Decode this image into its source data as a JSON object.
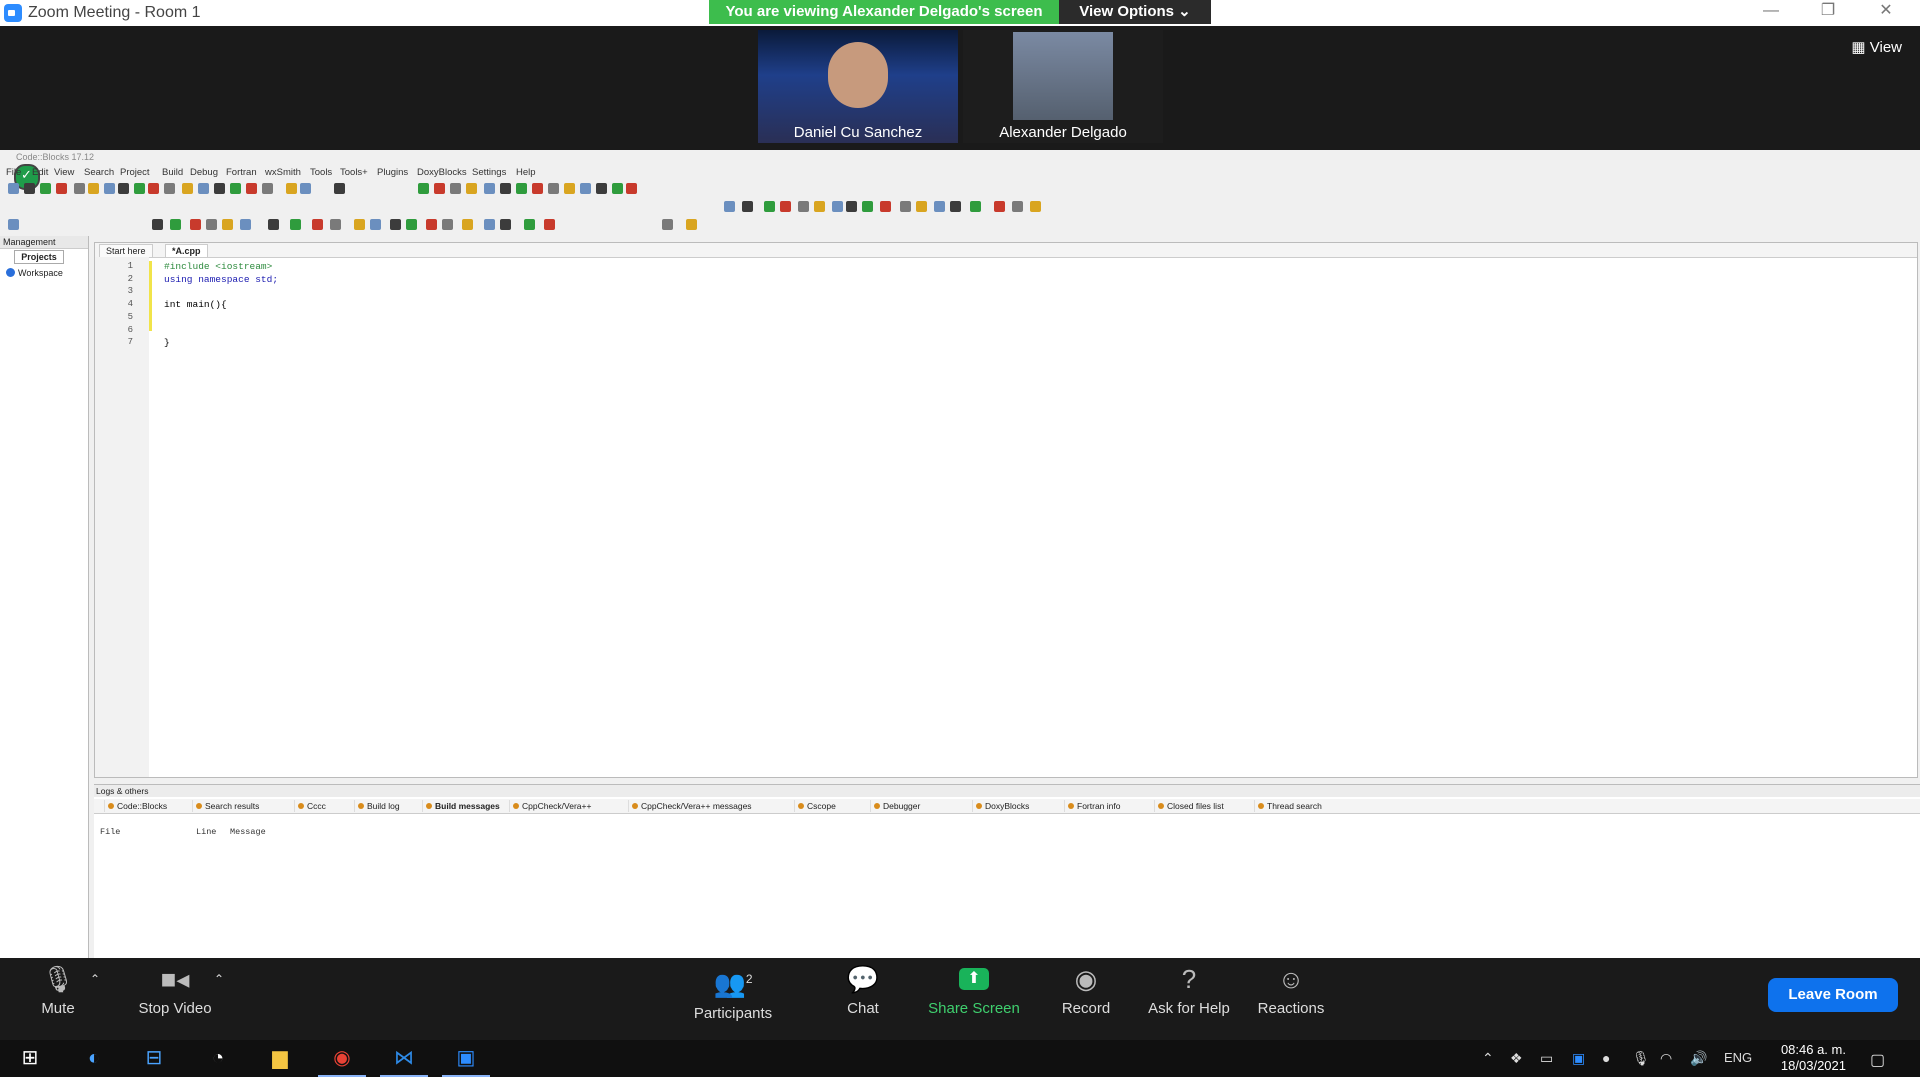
{
  "zoom": {
    "window_title": "Zoom Meeting - Room 1",
    "viewing_banner": "You are viewing Alexander Delgado's screen",
    "view_options": "View Options ⌄",
    "view_label": "View",
    "participants": [
      {
        "name": "Daniel Cu Sanchez"
      },
      {
        "name": "Alexander Delgado"
      }
    ],
    "controls": {
      "mute": "Mute",
      "stop_video": "Stop Video",
      "participants": "Participants",
      "participants_count": "2",
      "chat": "Chat",
      "share_screen": "Share Screen",
      "record": "Record",
      "ask_for_help": "Ask for Help",
      "reactions": "Reactions",
      "leave_room": "Leave Room"
    }
  },
  "codeblocks": {
    "title": "Code::Blocks 17.12",
    "menu": [
      "File",
      "Edit",
      "View",
      "Search",
      "Project",
      "Build",
      "Debug",
      "Fortran",
      "wxSmith",
      "Tools",
      "Tools+",
      "Plugins",
      "DoxyBlocks",
      "Settings",
      "Help"
    ],
    "management": {
      "header": "Management",
      "tab": "Projects",
      "workspace": "Workspace"
    },
    "editor_tabs": [
      "Start here",
      "*A.cpp"
    ],
    "code_lines": [
      {
        "n": "1",
        "text": "#include <iostream>"
      },
      {
        "n": "2",
        "text": "using namespace std;"
      },
      {
        "n": "3",
        "text": ""
      },
      {
        "n": "4",
        "text": "int main(){"
      },
      {
        "n": "5",
        "text": ""
      },
      {
        "n": "6",
        "text": ""
      },
      {
        "n": "7",
        "text": "}"
      }
    ],
    "logs": {
      "header": "Logs & others",
      "tabs": [
        "Code::Blocks",
        "Search results",
        "Cccc",
        "Build log",
        "Build messages",
        "CppCheck/Vera++",
        "CppCheck/Vera++ messages",
        "Cscope",
        "Debugger",
        "DoxyBlocks",
        "Fortran info",
        "Closed files list",
        "Thread search"
      ],
      "columns": [
        "File",
        "Line",
        "Message"
      ]
    }
  },
  "taskbar": {
    "language": "ENG",
    "time": "08:46 a. m.",
    "date": "18/03/2021"
  },
  "colors": {
    "banner_green": "#3dbd4d",
    "leave_blue": "#0e72ed",
    "share_green": "#19b35a"
  }
}
